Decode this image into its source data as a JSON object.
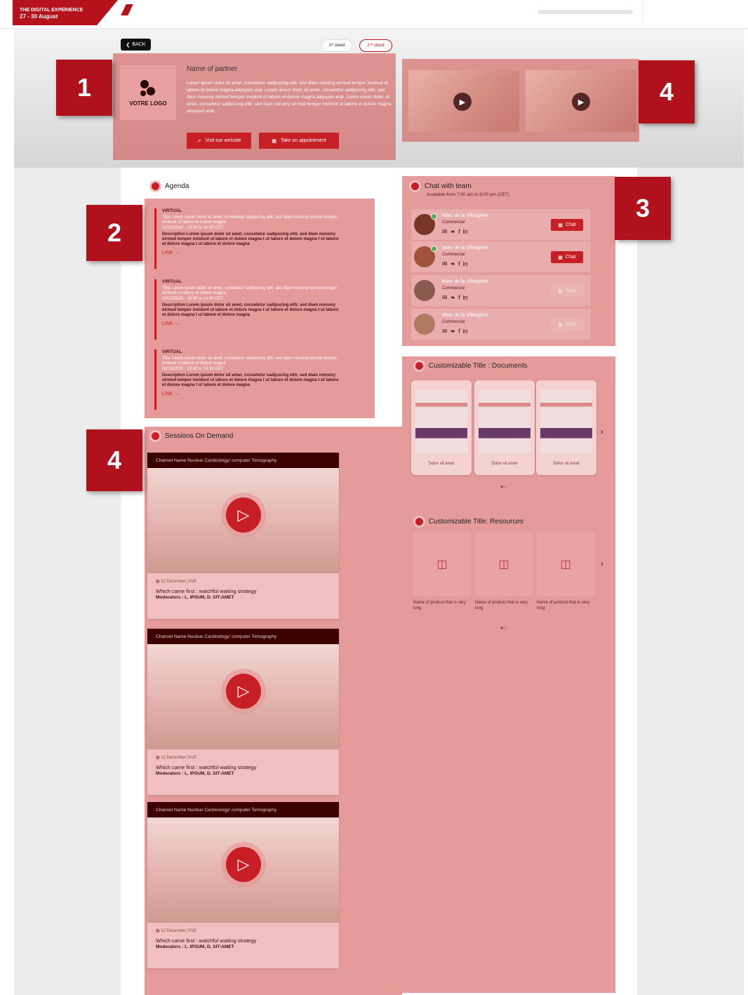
{
  "header": {
    "brand_line1": "THE DIGITAL EXPERIENCE",
    "brand_line2": "27 - 30 August"
  },
  "nav": {
    "back_label": "BACK",
    "stand1_label": "1ˢᵗ stand",
    "stand2_label": "2ⁿᵈ stand"
  },
  "badges": [
    "1",
    "2",
    "3",
    "4",
    "4"
  ],
  "partner": {
    "logo_text": "VOTRE LOGO",
    "name": "Name of partner",
    "description": "Lorem ipsum dolor sit amet, consetetur sadipscing elitr, sed diam nonumy eirmod tempor invidunt ut labore et dolore magna aliquyam erat. Lorem ipsum dolor sit amet, consetetur sadipscing elitr, sed diam nonumy eirmod tempor invidunt ut labore et dolore magna aliquyam erat. Lorem ipsum dolor sit amet, consetetur sadipscing elitr, sed diam nonumy eirmod tempor invidunt ut labore et dolore magna aliquyam erat.",
    "website_label": "Visit our website",
    "appointment_label": "Take an appointment"
  },
  "agenda": {
    "title": "Agenda",
    "items": [
      {
        "type": "VIRTUAL",
        "title": "Titre Lorem ipsum dolor sit amet, consetetur sadipscing elitr, sed diam nonumy eirmod tempor invidunt ut labore et dolore magna",
        "date": "02/10/2020 - 13:30 to 14:30 CET",
        "description": "Description Lorem ipsum dolor sit amet, consetetur sadipscing elitr, sed diam nonumy eirmod tempor invidunt ut labore et dolore magna t ut labore et dolore magna t ut labore et dolore magna t ut labore et dolore magna",
        "link": "LINK →"
      },
      {
        "type": "VIRTUAL",
        "title": "Titre Lorem ipsum dolor sit amet, consetetur sadipscing elitr, sed diam nonumy eirmod tempor invidunt ut labore et dolore magna",
        "date": "02/10/2020 - 13:30 to 14:30 CET",
        "description": "Description Lorem ipsum dolor sit amet, consetetur sadipscing elitr, sed diam nonumy eirmod tempor invidunt ut labore et dolore magna t ut labore et dolore magna t ut labore et dolore magna t ut labore et dolore magna",
        "link": "LINK →"
      },
      {
        "type": "VIRTUAL",
        "title": "Titre Lorem ipsum dolor sit amet, consetetur sadipscing elitr, sed diam nonumy eirmod tempor invidunt ut labore et dolore magna",
        "date": "02/10/2020 - 13:30 to 14:30 CET",
        "description": "Description Lorem ipsum dolor sit amet, consetetur sadipscing elitr, sed diam nonumy eirmod tempor invidunt ut labore et dolore magna t ut labore et dolore magna t ut labore et dolore magna t ut labore et dolore magna",
        "link": "LINK →"
      }
    ]
  },
  "chat": {
    "title": "Chat with team",
    "availability": "Available from 7:00 am to 8:00 pm (CET)",
    "members": [
      {
        "name": "Marc de la Villargière",
        "role": "Commercial",
        "online": true,
        "chat_label": "Chat",
        "chat_enabled": true
      },
      {
        "name": "Marc de la Villargière",
        "role": "Commercial",
        "online": true,
        "chat_label": "Chat",
        "chat_enabled": true
      },
      {
        "name": "Marc de la Villargière",
        "role": "Commercial",
        "online": false,
        "chat_label": "Chat",
        "chat_enabled": false
      },
      {
        "name": "Marc de la Villargière",
        "role": "Commercial",
        "online": false,
        "chat_label": "Chat",
        "chat_enabled": false
      }
    ]
  },
  "documents": {
    "title": "Customizable Title : Documents",
    "items": [
      "Dolor sit amet",
      "Dolor sit amet",
      "Dolor sit amet"
    ],
    "pager": "●○"
  },
  "resources": {
    "title": "Customizable Title: Resources",
    "items": [
      "Name of product that is very long",
      "Name of product that is very long",
      "Name of product that is very long"
    ],
    "pager": "●○"
  },
  "sessions": {
    "title": "Sessions On Demand",
    "items": [
      {
        "channel": "Channel Name Nuclear Cardioology/ computer Tomography",
        "date": "12 December 2020",
        "title": "Which came first : watchful waiting strategy",
        "moderators": "Moderators : L. IPSUM, D. SIT-AMET"
      },
      {
        "channel": "Channel Name Nuclear Cardioology/ computer Tomography",
        "date": "12 December 2020",
        "title": "Which came first : watchful waiting strategy",
        "moderators": "Moderators : L. IPSUM, D. SIT-AMET"
      },
      {
        "channel": "Channel Name Nuclear Cardioology/ computer Tomography",
        "date": "12 December 2020",
        "title": "Which came first : watchful waiting strategy",
        "moderators": "Moderators : L. IPSUM, D. SIT-AMET"
      }
    ]
  },
  "colors": {
    "accent": "#c81e26",
    "badge": "#b0111c",
    "overlay": "#d24848"
  }
}
